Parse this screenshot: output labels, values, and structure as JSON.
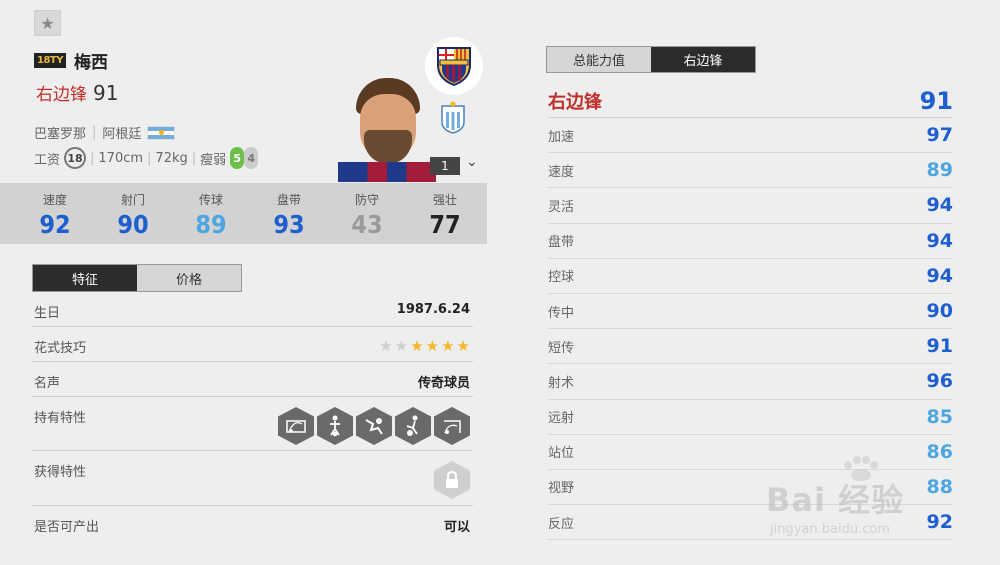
{
  "colors": {
    "pos_red": "#c0302b",
    "blue_dark": "#1e5fd0",
    "blue_light": "#4da6e0",
    "grey": "#9a9a9a",
    "black": "#222222"
  },
  "header": {
    "favorite_icon": "star-icon",
    "season_badge": "18TY",
    "player_name": "梅西",
    "position": "右边锋",
    "overall": "91",
    "club": "巴塞罗那",
    "nation": "阿根廷",
    "wage_label": "工资",
    "wage": "18",
    "height": "170cm",
    "weight": "72kg",
    "body_type": "瘦弱",
    "left_foot": "5",
    "right_foot": "4",
    "rank": "1"
  },
  "stats": [
    {
      "label": "速度",
      "value": "92",
      "color": "#1e5fd0"
    },
    {
      "label": "射门",
      "value": "90",
      "color": "#1e5fd0"
    },
    {
      "label": "传球",
      "value": "89",
      "color": "#4da6e0"
    },
    {
      "label": "盘带",
      "value": "93",
      "color": "#1e5fd0"
    },
    {
      "label": "防守",
      "value": "43",
      "color": "#9a9a9a"
    },
    {
      "label": "强壮",
      "value": "77",
      "color": "#222222"
    }
  ],
  "left_tabs": {
    "active": "特征",
    "inactive": "价格"
  },
  "attributes": {
    "birthday": {
      "label": "生日",
      "value": "1987.6.24"
    },
    "skill_moves": {
      "label": "花式技巧",
      "stars_total": 6,
      "stars_on": 4
    },
    "reputation": {
      "label": "名声",
      "value": "传奇球员"
    },
    "traits": {
      "label": "持有特性",
      "icons": [
        "finesse-shot-icon",
        "trait-player-icon",
        "flair-icon",
        "dribbler-icon",
        "long-shot-icon"
      ]
    },
    "acquired": {
      "label": "获得特性",
      "icon": "lock-icon"
    },
    "obtainable": {
      "label": "是否可产出",
      "value": "可以"
    }
  },
  "right_tabs": {
    "inactive": "总能力值",
    "active": "右边锋"
  },
  "position_rating": {
    "label": "右边锋",
    "value": "91"
  },
  "details": [
    {
      "label": "加速",
      "value": "97",
      "color": "#1e5fd0"
    },
    {
      "label": "速度",
      "value": "89",
      "color": "#4da6e0"
    },
    {
      "label": "灵活",
      "value": "94",
      "color": "#1e5fd0"
    },
    {
      "label": "盘带",
      "value": "94",
      "color": "#1e5fd0"
    },
    {
      "label": "控球",
      "value": "94",
      "color": "#1e5fd0"
    },
    {
      "label": "传中",
      "value": "90",
      "color": "#1e5fd0"
    },
    {
      "label": "短传",
      "value": "91",
      "color": "#1e5fd0"
    },
    {
      "label": "射术",
      "value": "96",
      "color": "#1e5fd0"
    },
    {
      "label": "远射",
      "value": "85",
      "color": "#4da6e0"
    },
    {
      "label": "站位",
      "value": "86",
      "color": "#4da6e0"
    },
    {
      "label": "视野",
      "value": "88",
      "color": "#4da6e0"
    },
    {
      "label": "反应",
      "value": "92",
      "color": "#1e5fd0"
    }
  ],
  "watermark": {
    "text": "Bai 经验",
    "url": "jingyan.baidu.com"
  }
}
